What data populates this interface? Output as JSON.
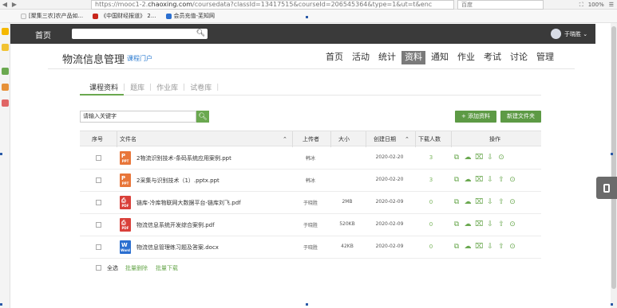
{
  "browser": {
    "url_prefix": "https://mooc1-2.",
    "url_host": "chaoxing.com",
    "url_rest": "/coursedata?classId=13417515&courseId=206545364&type=1&ut=t&enc",
    "search_engine": "百度",
    "zoom": "100%",
    "bookmarks": [
      "[聚集三农]农产品如...",
      "《中国财经报道》 2...",
      "会员充值-芜知网"
    ]
  },
  "site": {
    "home": "首页",
    "search_value": "",
    "user_name": "于晓胜"
  },
  "course": {
    "title": "物流信息管理",
    "portal": "课程门户",
    "nav": [
      "首页",
      "活动",
      "统计",
      "资料",
      "通知",
      "作业",
      "考试",
      "讨论",
      "管理"
    ],
    "active_nav": "资料"
  },
  "subtabs": [
    "课程资料",
    "题库",
    "作业库",
    "试卷库"
  ],
  "search": {
    "placeholder": "请输入关键字"
  },
  "actions": {
    "add": "+ 添加资料",
    "new_folder": "新建文件夹"
  },
  "table": {
    "headers": [
      "序号",
      "文件名",
      "上传者",
      "大小",
      "创建日期",
      "下载人数",
      "操作"
    ],
    "rows": [
      {
        "type": "ppt",
        "name": "2物流识别技术-条码系统应用案例.ppt",
        "uploader": "韩冰",
        "size": "",
        "date": "2020-02-20",
        "downloads": "3"
      },
      {
        "type": "ppt",
        "name": "2采集与识别技术（1）.pptx.ppt",
        "uploader": "韩冰",
        "size": "",
        "date": "2020-02-20",
        "downloads": "3"
      },
      {
        "type": "pdf",
        "name": "链库-冷库物联网大数据平台-链库刘飞.pdf",
        "uploader": "于晓胜",
        "size": "2MB",
        "date": "2020-02-09",
        "downloads": "0"
      },
      {
        "type": "pdf",
        "name": "物流信息系统开发综合案例.pdf",
        "uploader": "于晓胜",
        "size": "520KB",
        "date": "2020-02-09",
        "downloads": "0"
      },
      {
        "type": "doc",
        "name": "物流信息管理练习题及答案.docx",
        "uploader": "于晓胜",
        "size": "42KB",
        "date": "2020-02-09",
        "downloads": "0"
      }
    ]
  },
  "footer": {
    "select_all": "全选",
    "batch_delete": "批量删除",
    "batch_download": "批量下载"
  },
  "colors": {
    "accent_green": "#6aa84f",
    "topbar": "#3a3a3a",
    "active_nav": "#7a7a7a"
  }
}
